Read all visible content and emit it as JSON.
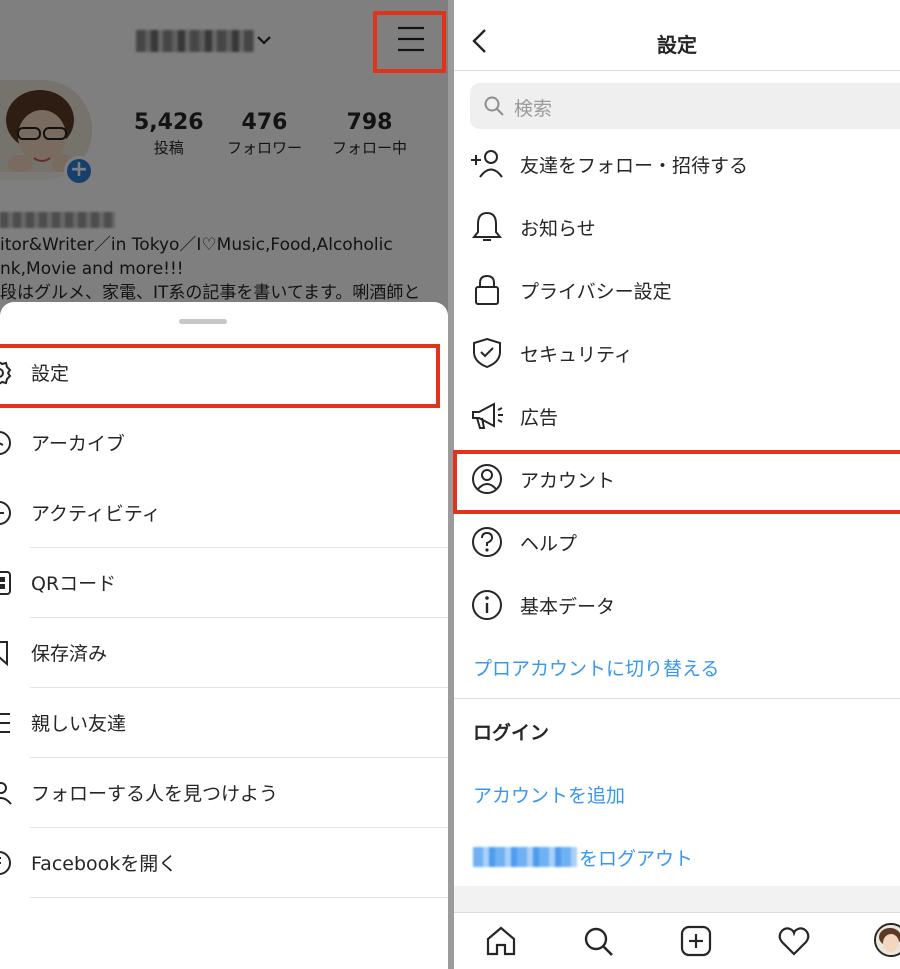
{
  "left_panel": {
    "profile_stats": [
      {
        "value": "5,426",
        "label": "投稿"
      },
      {
        "value": "476",
        "label": "フォロワー"
      },
      {
        "value": "798",
        "label": "フォロー中"
      }
    ],
    "bio_lines": [
      "itor&Writer／in Tokyo／I♡Music,Food,Alcoholic",
      "nk,Movie and more!!!",
      "段はグルメ、家電、IT系の記事を書いてます。唎酒師と"
    ],
    "menu_items": [
      {
        "label": "設定",
        "icon": "gear-icon"
      },
      {
        "label": "アーカイブ",
        "icon": "archive-icon"
      },
      {
        "label": "アクティビティ",
        "icon": "activity-icon"
      },
      {
        "label": "QRコード",
        "icon": "qr-code-icon"
      },
      {
        "label": "保存済み",
        "icon": "bookmark-icon"
      },
      {
        "label": "親しい友達",
        "icon": "close-friends-icon"
      },
      {
        "label": "フォローする人を見つけよう",
        "icon": "add-person-icon"
      },
      {
        "label": "Facebookを開く",
        "icon": "facebook-icon"
      }
    ]
  },
  "right_panel": {
    "title": "設定",
    "search": {
      "placeholder": "検索"
    },
    "settings_items": [
      {
        "label": "友達をフォロー・招待する",
        "icon": "add-friend-icon"
      },
      {
        "label": "お知らせ",
        "icon": "bell-icon"
      },
      {
        "label": "プライバシー設定",
        "icon": "lock-icon"
      },
      {
        "label": "セキュリティ",
        "icon": "shield-check-icon"
      },
      {
        "label": "広告",
        "icon": "megaphone-icon"
      },
      {
        "label": "アカウント",
        "icon": "account-circle-icon"
      },
      {
        "label": "ヘルプ",
        "icon": "help-icon"
      },
      {
        "label": "基本データ",
        "icon": "info-icon"
      }
    ],
    "switch_to_pro": "プロアカウントに切り替える",
    "login_header": "ログイン",
    "add_account": "アカウントを追加",
    "logout_suffix": "をログアウト",
    "tab_bar": [
      "home-icon",
      "search-icon",
      "new-post-icon",
      "heart-icon",
      "profile-avatar"
    ]
  },
  "colors": {
    "highlight_red": "#e3321a",
    "link_blue": "#3897f0",
    "plus_badge_blue": "#2e7ed6"
  }
}
